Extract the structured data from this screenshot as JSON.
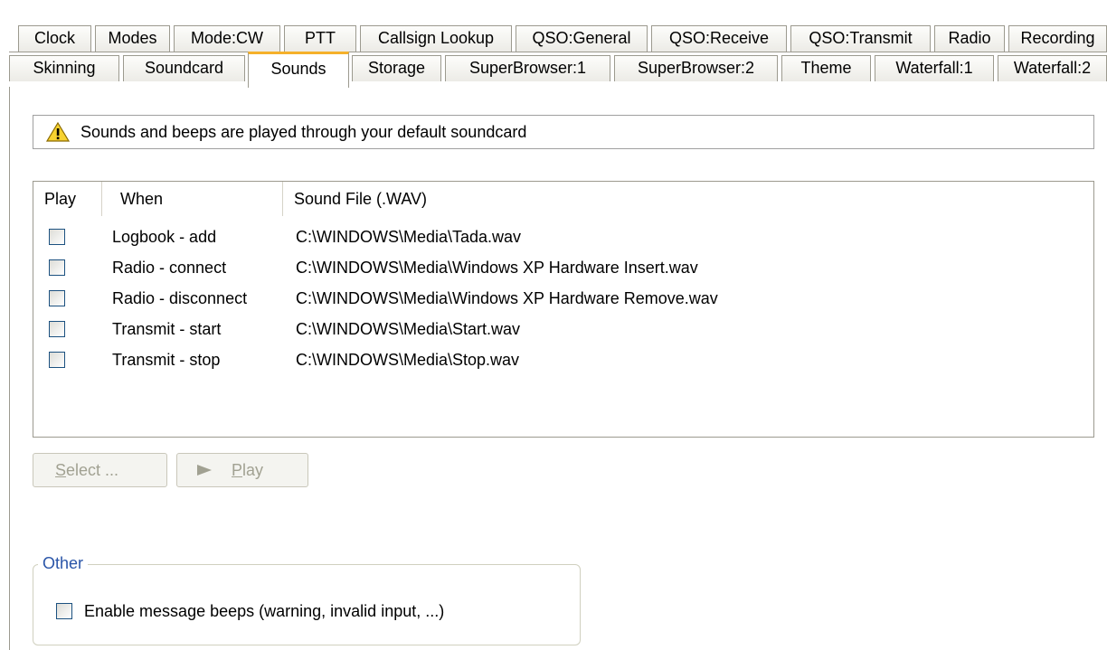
{
  "tabs_row1": [
    "Clock",
    "Modes",
    "Mode:CW",
    "PTT",
    "Callsign Lookup",
    "QSO:General",
    "QSO:Receive",
    "QSO:Transmit",
    "Radio",
    "Recording"
  ],
  "tabs_row2": [
    "Skinning",
    "Soundcard",
    "Sounds",
    "Storage",
    "SuperBrowser:1",
    "SuperBrowser:2",
    "Theme",
    "Waterfall:1",
    "Waterfall:2"
  ],
  "active_tab": "Sounds",
  "info_message": "Sounds and beeps are played through your default soundcard",
  "list": {
    "headers": [
      "Play",
      "When",
      "Sound File (.WAV)"
    ],
    "rows": [
      {
        "play": false,
        "when": "Logbook - add",
        "file": "C:\\WINDOWS\\Media\\Tada.wav"
      },
      {
        "play": false,
        "when": "Radio - connect",
        "file": "C:\\WINDOWS\\Media\\Windows XP Hardware Insert.wav"
      },
      {
        "play": false,
        "when": "Radio - disconnect",
        "file": "C:\\WINDOWS\\Media\\Windows XP Hardware Remove.wav"
      },
      {
        "play": false,
        "when": "Transmit - start",
        "file": "C:\\WINDOWS\\Media\\Start.wav"
      },
      {
        "play": false,
        "when": "Transmit - stop",
        "file": "C:\\WINDOWS\\Media\\Stop.wav"
      }
    ]
  },
  "buttons": {
    "select_prefix": "S",
    "select_rest": "elect ...",
    "play_prefix": "P",
    "play_rest": "lay"
  },
  "other_group": {
    "title": "Other",
    "enable_beeps_label": "Enable message beeps (warning, invalid input, ...)",
    "enable_beeps_checked": false
  }
}
